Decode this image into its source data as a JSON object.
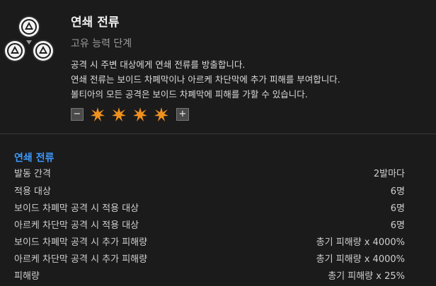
{
  "skill": {
    "name": "연쇄 전류",
    "tier": "고유 능력 단계",
    "description": [
      "공격 시 주변 대상에게 연쇄 전류를 방출합니다.",
      "연쇄 전류는 보이드 차폐막이나 아르케 차단막에 추가 피해를 부여합니다.",
      "볼티아의 모든 공격은 보이드 차폐막에 피해를 가할 수 있습니다."
    ]
  },
  "level": {
    "minus_label": "−",
    "plus_label": "+",
    "filled": 4,
    "max": 4,
    "star_color": "#f0921f"
  },
  "details": {
    "section_title": "연쇄 전류",
    "rows": [
      {
        "label": "발동 간격",
        "value": "2발마다"
      },
      {
        "label": "적용 대상",
        "value": "6명"
      },
      {
        "label": "보이드 차폐막 공격 시 적용 대상",
        "value": "6명"
      },
      {
        "label": "아르케 차단막 공격 시 적용 대상",
        "value": "6명"
      },
      {
        "label": "보이드 차폐막 공격 시 추가 피해량",
        "value": "총기 피해량 x 4000%"
      },
      {
        "label": "아르케 차단막 공격 시 추가 피해량",
        "value": "총기 피해량 x 4000%"
      },
      {
        "label": "피해량",
        "value": "총기 피해량 x 25%"
      }
    ]
  },
  "colors": {
    "accent": "#3d9bff",
    "background": "#1b1b1c"
  },
  "icons": [
    "chain-current-skill-icon",
    "burst-star-icon"
  ]
}
